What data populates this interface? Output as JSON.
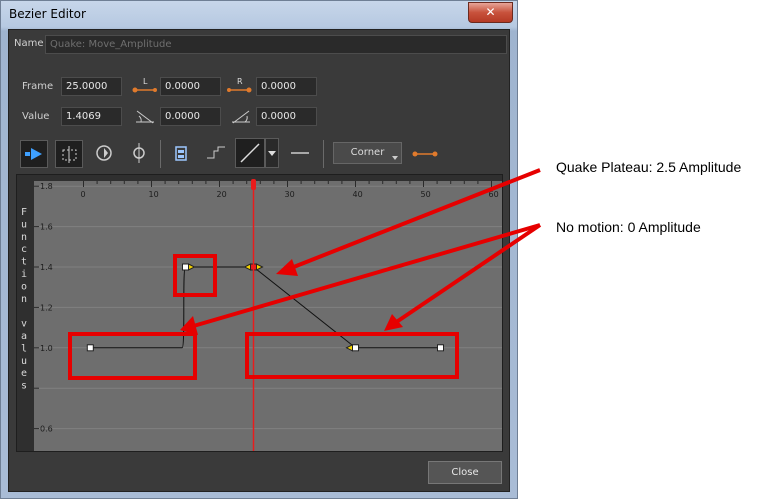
{
  "window": {
    "title": "Bezier Editor",
    "close_glyph": "✕"
  },
  "name_row": {
    "label": "Name",
    "value": "Quake: Move_Amplitude"
  },
  "frame_row": {
    "label": "Frame",
    "frame": "25.0000",
    "left_handle": "0.0000",
    "right_handle": "0.0000",
    "left_icon_text": "L",
    "right_icon_text": "R"
  },
  "value_row": {
    "label": "Value",
    "value": "1.4069",
    "left_angle": "0.0000",
    "right_angle": "0.0000"
  },
  "toolbar": {
    "icons": [
      "play-selected-icon",
      "grid-snap-icon",
      "rotate-view-icon",
      "center-view-icon",
      "key-icon",
      "step-icon",
      "linear-curve-icon",
      "flat-curve-icon",
      "handle-icon"
    ],
    "interpolation_label": "Corner"
  },
  "plot": {
    "y_axis_title": "Function values",
    "x_ticks": [
      "0",
      "10",
      "20",
      "30",
      "40",
      "50",
      "60"
    ],
    "y_ticks": [
      "1.8",
      "1.6",
      "1.4",
      "1.2",
      "1.0",
      "0.6"
    ],
    "current_frame": 25,
    "accent": "#e81c1c"
  },
  "footer": {
    "close_label": "Close"
  },
  "annotations": {
    "plateau": "Quake Plateau: 2.5 Amplitude",
    "no_motion": "No motion: 0 Amplitude",
    "color": "#e60000"
  }
}
